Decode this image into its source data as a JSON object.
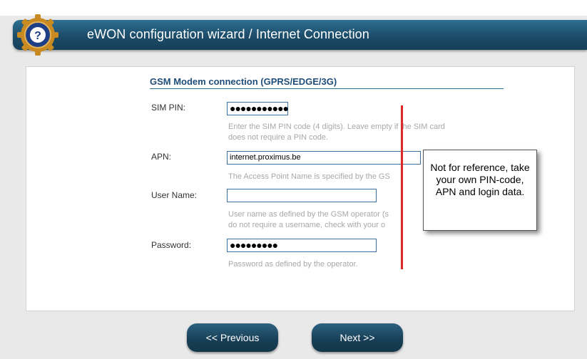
{
  "header": {
    "title": "eWON configuration wizard / Internet Connection",
    "icon": "help-icon"
  },
  "section": {
    "title": "GSM Modem connection (GPRS/EDGE/3G)"
  },
  "fields": {
    "sim_pin": {
      "label": "SIM PIN:",
      "value": "●●●●●●●●●●●",
      "hint_line1": "Enter the SIM PIN code (4 digits). Leave empty if the SIM card",
      "hint_line2": "does not require a PIN code."
    },
    "apn": {
      "label": "APN:",
      "value": "internet.proximus.be",
      "hint_line1": "The Access Point Name is specified by the GS"
    },
    "user_name": {
      "label": "User Name:",
      "value": "",
      "hint_line1": "User name as defined by the GSM operator (s",
      "hint_line2": "do not require a username, check with your o"
    },
    "password": {
      "label": "Password:",
      "value": "●●●●●●●●●",
      "hint_line1": "Password as defined by the operator."
    }
  },
  "annotation": {
    "text": "Not for reference, take your own PIN-code, APN and login data."
  },
  "buttons": {
    "previous": "<< Previous",
    "next": "Next >>"
  },
  "colors": {
    "header": "#1c4c69",
    "accent": "#1f4e79",
    "annotation_line": "#e02626"
  }
}
